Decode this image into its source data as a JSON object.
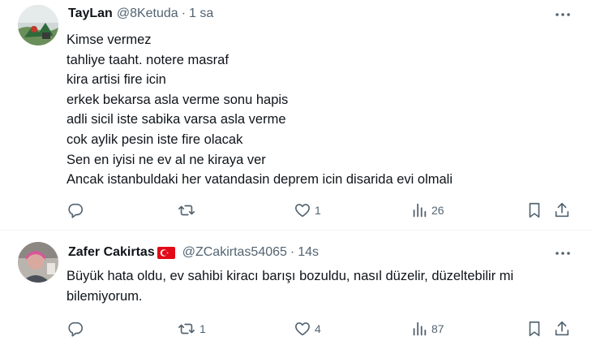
{
  "tweets": [
    {
      "name": "TayLan",
      "handle": "@8Ketuda",
      "separator": "·",
      "time": "1 sa",
      "lines": [
        "Kimse vermez",
        "tahliye taaht. notere masraf",
        "kira artisi fire icin",
        "erkek bekarsa asla verme sonu hapis",
        "adli sicil iste sabika varsa asla verme",
        "cok aylik pesin iste fire olacak",
        "Sen en iyisi ne ev al ne kiraya ver",
        "Ancak istanbuldaki her vatandasin deprem icin disarida evi olmali"
      ],
      "replies": "",
      "retweets": "",
      "likes": "1",
      "views": "26"
    },
    {
      "name": "Zafer Cakirtas",
      "handle": "@ZCakirtas54065",
      "separator": "·",
      "time": "14s",
      "lines": [
        "Büyük hata oldu, ev sahibi kiracı barışı bozuldu, nasıl düzelir, düzeltebilir mi",
        "bilemiyorum."
      ],
      "replies": "",
      "retweets": "1",
      "likes": "4",
      "views": "87"
    }
  ],
  "icons": {
    "reply": "reply-icon",
    "retweet": "retweet-icon",
    "like": "like-icon",
    "views": "views-icon",
    "bookmark": "bookmark-icon",
    "share": "share-icon",
    "more": "more-icon",
    "flag": "turkey-flag-icon"
  },
  "colors": {
    "text": "#0f1419",
    "secondary": "#536471",
    "divider": "#eff3f4",
    "flag": "#e30a17"
  }
}
